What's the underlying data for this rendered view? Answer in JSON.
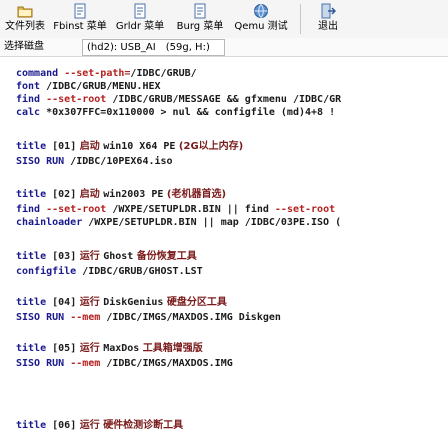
{
  "toolbar": {
    "items": [
      {
        "label": "文件列表",
        "icon": "folder-icon"
      },
      {
        "label": "Fbinst 菜单",
        "icon": "document-icon"
      },
      {
        "label": "Grldr 菜单",
        "icon": "document-icon"
      },
      {
        "label": "Burg 菜单",
        "icon": "document-icon"
      },
      {
        "label": "Qemu 测试",
        "icon": "globe-icon"
      },
      {
        "label": "退出",
        "icon": "exit-icon"
      }
    ]
  },
  "pathbar": {
    "label": "选择磁盘",
    "device": "(hd2): USB_AI",
    "size": "(59g, H:)"
  },
  "editor": {
    "l1": {
      "kw": "command",
      "opt": "--set-path=",
      "rest": "/IDBC/GRUB/"
    },
    "l2": {
      "kw": "font",
      "rest": " /IDBC/GRUB/MENU.HEX"
    },
    "l3": {
      "kw": "find",
      "opt": " --set-root",
      "rest": " /IDBC/GRUB/MESSAGE && gfxmenu /IDBC/GR"
    },
    "l4": {
      "kw": "calc",
      "rest": " *0x307FFC=0x110000 > nul && configfile (md)4+8 !"
    },
    "e1_title": {
      "kw": "title",
      "num": " [01]",
      "cjk": " 启动 ",
      "rest": "win10 X64 PE",
      "cjk2": " (2G以上内存)"
    },
    "e1_cmd": {
      "kw": "SISO RUN",
      "rest": " /IDBC/10PEX64.iso"
    },
    "e2_title": {
      "kw": "title",
      "num": " [02]",
      "cjk": " 启动 ",
      "rest": "win2003 PE",
      "cjk2": " (老机器首选)"
    },
    "e2_cmd1": {
      "kw": "find",
      "opt": " --set-root",
      "rest": " /WXPE/SETUPLDR.BIN || find ",
      "opt2": "--set-root"
    },
    "e2_cmd2": {
      "kw": "chainloader",
      "rest": " /WXPE/SETUPLDR.BIN || map /IDBC/03PE.ISO ("
    },
    "e3_title": {
      "kw": "title",
      "num": " [03]",
      "cjk": " 运行 ",
      "rest": "Ghost",
      "cjk2": " 备份恢复工具"
    },
    "e3_cmd": {
      "kw": "configfile",
      "rest": " /IDBC/GRUB/GHOST.LST"
    },
    "e4_title": {
      "kw": "title",
      "num": " [04]",
      "cjk": " 运行 ",
      "rest": "DiskGenius",
      "cjk2": " 硬盘分区工具"
    },
    "e4_cmd": {
      "kw": "SISO RUN",
      "opt": " --mem",
      "rest": " /IDBC/IMGS/MAXDOS.IMG Diskgen"
    },
    "e5_title": {
      "kw": "title",
      "num": " [05]",
      "cjk": " 运行 ",
      "rest": "MaxDos",
      "cjk2": " 工具箱增强版"
    },
    "e5_cmd": {
      "kw": "SISO RUN",
      "opt": " --mem",
      "rest": " /IDBC/IMGS/MAXDOS.IMG"
    },
    "e6_title": {
      "kw": "title",
      "num": " [06]",
      "cjk": " 运行 ",
      "cjk2": "硬件检测诊断工具"
    }
  }
}
